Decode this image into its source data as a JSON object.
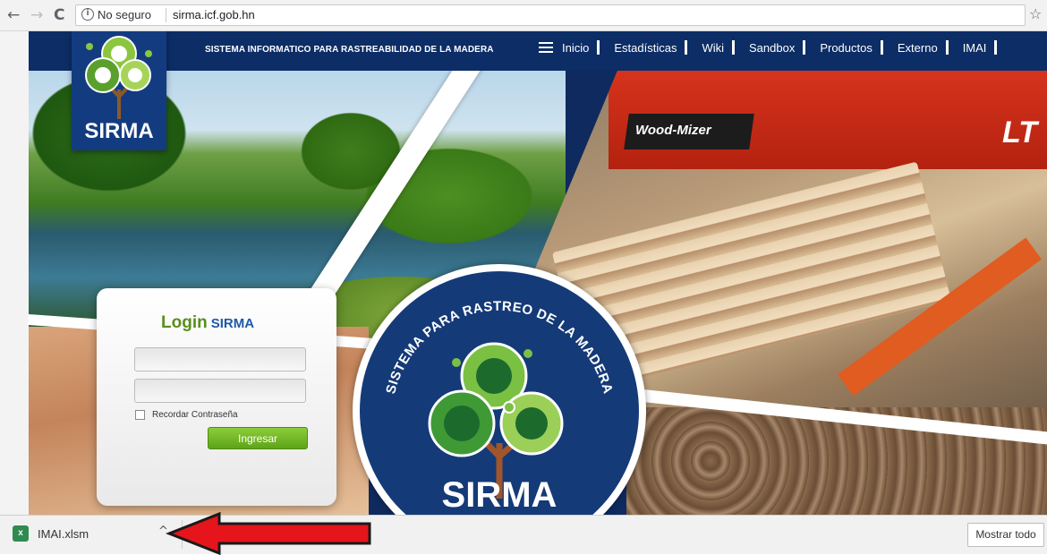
{
  "browser": {
    "back_icon": "←",
    "forward_icon": "→",
    "reload_icon": "C",
    "info_icon": "i",
    "security_label": "No seguro",
    "url": "sirma.icf.gob.hn",
    "bookmark_icon": "☆"
  },
  "header": {
    "logo_text": "SIRMA",
    "site_title": "SISTEMA INFORMATICO PARA RASTREABILIDAD DE LA MADERA",
    "menu": [
      "Inicio",
      "Estadísticas",
      "Wiki",
      "Sandbox",
      "Productos",
      "Externo",
      "IMAI"
    ]
  },
  "scenery": {
    "brand_text": "Wood-Mizer",
    "machine_text": "LT"
  },
  "emblem": {
    "arc_text": "SISTEMA PARA RASTREO DE LA MADERA",
    "name": "SIRMA"
  },
  "login": {
    "title": "Login",
    "title_suffix": "SIRMA",
    "username_value": "",
    "password_value": "",
    "remember_label": "Recordar Contraseña",
    "remember_checked": false,
    "submit_label": "Ingresar"
  },
  "download_bar": {
    "file_icon_text": "x",
    "file_name": "IMAI.xlsm",
    "chevron_icon": "^",
    "show_all_label": "Mostrar todo"
  },
  "colors": {
    "header_blue": "#0c2d66",
    "login_green": "#5a8e1d",
    "button_green": "#6bb322",
    "arrow_red": "#e5151b"
  }
}
